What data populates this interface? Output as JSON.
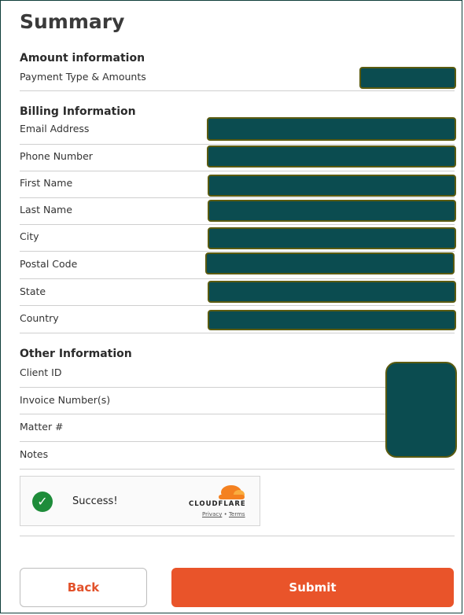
{
  "title": "Summary",
  "amount": {
    "heading": "Amount information",
    "rows": [
      {
        "label": "Payment Type & Amounts"
      }
    ]
  },
  "billing": {
    "heading": "Billing Information",
    "rows": [
      {
        "label": "Email Address"
      },
      {
        "label": "Phone Number"
      },
      {
        "label": "First Name"
      },
      {
        "label": "Last Name"
      },
      {
        "label": "City"
      },
      {
        "label": "Postal Code"
      },
      {
        "label": "State"
      },
      {
        "label": "Country"
      }
    ]
  },
  "other": {
    "heading": "Other Information",
    "rows": [
      {
        "label": "Client ID"
      },
      {
        "label": "Invoice Number(s)"
      },
      {
        "label": "Matter #"
      },
      {
        "label": "Notes"
      }
    ]
  },
  "captcha": {
    "status": "Success!",
    "brand": "CLOUDFLARE",
    "privacy": "Privacy",
    "separator": "•",
    "terms": "Terms"
  },
  "buttons": {
    "back": "Back",
    "submit": "Submit"
  },
  "colors": {
    "accent": "#e9542a",
    "redaction": "#0b4c50",
    "success": "#1e8c3a"
  }
}
